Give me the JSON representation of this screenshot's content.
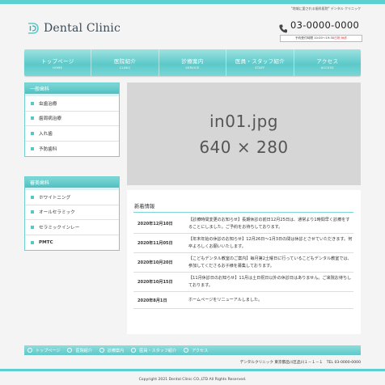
{
  "header": {
    "tagline": "\"地域に愛される歯科医院\" デンタル クリニック",
    "logo_text": "Dental Clinic",
    "logo_icon": "tooth-icon",
    "phone": "03-0000-0000",
    "hours_prefix": "予約受付時間 10:00〜19:30 ",
    "hours_closed": "日祝 休診"
  },
  "nav": [
    {
      "jp": "トップページ",
      "en": "HOME"
    },
    {
      "jp": "医院紹介",
      "en": "CLINIC"
    },
    {
      "jp": "診療案内",
      "en": "SERVICE"
    },
    {
      "jp": "医員・スタッフ紹介",
      "en": "STAFF"
    },
    {
      "jp": "アクセス",
      "en": "ACCESS"
    }
  ],
  "sidebar": {
    "general": {
      "title": "一般歯科",
      "items": [
        "虫歯治療",
        "歯周病治療",
        "入れ歯",
        "予防歯科"
      ]
    },
    "aesthetic": {
      "title": "審美歯科",
      "items": [
        "ホワイトニング",
        "オールセラミック",
        "セラミックインレー",
        "PMTC"
      ]
    }
  },
  "main_image": {
    "line1": "in01.jpg",
    "line2": "640 × 280"
  },
  "news": {
    "title": "新着情報",
    "items": [
      {
        "date": "2020年12月10日",
        "text": "【診療時間変更のお知らせ】長期休診の前日12月25日は、通常より1時間早く診療をすることにしました。ご予約をお待ちしております。"
      },
      {
        "date": "2020年11月05日",
        "text": "【年末年始の休診のお知らせ】12月26日〜1月3日の間は休診とさせていただきます。何卒よろしくお願いいたします。"
      },
      {
        "date": "2020年10月20日",
        "text": "【こどもデンタル教室のご案内】毎月第2土曜日に行っているこどもデンタル教室では、参加してくださるお子様を募集しております。"
      },
      {
        "date": "2020年10月15日",
        "text": "【11月休診日のお知らせ】11月は土日祝日以外の休診日はありません。ご来院お待ちしております。"
      },
      {
        "date": "2020年8月1日",
        "text": "ホームページをリニューアルしました。"
      }
    ]
  },
  "footer": {
    "nav": [
      "トップページ",
      "医院紹介",
      "診療案内",
      "医員・スタッフ紹介",
      "アクセス"
    ],
    "address": "デンタルクリニック 東京都品川区品川１－１－１　TEL 03-0000-0000",
    "copyright": "Copyright 2021 Dental Clinic CO.,LTD All Rights Reserved."
  },
  "colors": {
    "accent": "#5ccfcf",
    "sidebar_head": "#4fc0c0",
    "image_placeholder": "#d6d6d6"
  }
}
